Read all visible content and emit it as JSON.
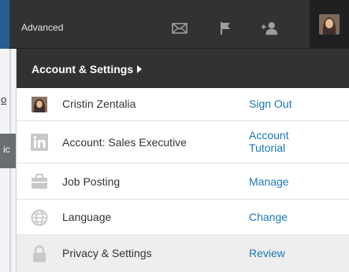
{
  "topbar": {
    "advanced_label": "Advanced",
    "icons": [
      "mail-icon",
      "flag-icon",
      "add-connection-icon",
      "profile-avatar"
    ]
  },
  "background": {
    "fragment_1": "o",
    "fragment_2": "ic"
  },
  "dropdown": {
    "title": "Account & Settings",
    "items": [
      {
        "icon": "profile-avatar",
        "label": "Cristin Zentalia",
        "action": "Sign Out"
      },
      {
        "icon": "linkedin-icon",
        "label": "Account: Sales Executive",
        "action": "Account Tutorial"
      },
      {
        "icon": "briefcase-icon",
        "label": "Job Posting",
        "action": "Manage"
      },
      {
        "icon": "globe-icon",
        "label": "Language",
        "action": "Change"
      },
      {
        "icon": "lock-icon",
        "label": "Privacy & Settings",
        "action": "Review"
      }
    ]
  },
  "colors": {
    "topbar_bg": "#303234",
    "link": "#1c77b3",
    "highlight_row": "#eeeeee",
    "icon_grey": "#c8c8c8"
  }
}
